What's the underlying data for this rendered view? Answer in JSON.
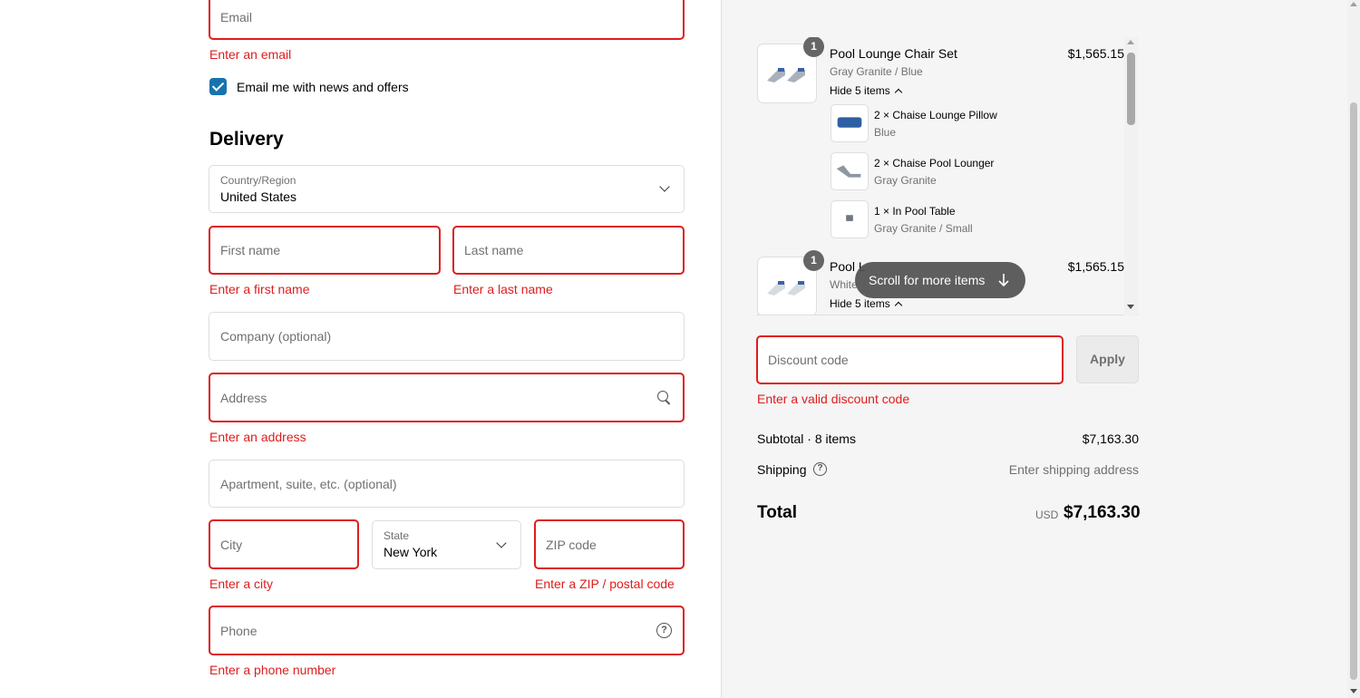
{
  "contact": {
    "email_placeholder": "Email",
    "email_error": "Enter an email",
    "news_label": "Email me with news and offers"
  },
  "delivery": {
    "heading": "Delivery",
    "country_label": "Country/Region",
    "country_value": "United States",
    "first_name_placeholder": "First name",
    "first_name_error": "Enter a first name",
    "last_name_placeholder": "Last name",
    "last_name_error": "Enter a last name",
    "company_placeholder": "Company (optional)",
    "address_placeholder": "Address",
    "address_error": "Enter an address",
    "apartment_placeholder": "Apartment, suite, etc. (optional)",
    "city_placeholder": "City",
    "city_error": "Enter a city",
    "state_label": "State",
    "state_value": "New York",
    "zip_placeholder": "ZIP code",
    "zip_error": "Enter a ZIP / postal code",
    "phone_placeholder": "Phone",
    "phone_error": "Enter a phone number"
  },
  "cart": {
    "items": [
      {
        "quantity": "1",
        "title": "Pool Lounge Chair Set",
        "variant": "Gray Granite / Blue",
        "price": "$1,565.15",
        "toggle": "Hide 5 items",
        "components": [
          {
            "title": "2 × Chaise Lounge Pillow",
            "variant": "Blue"
          },
          {
            "title": "2 × Chaise Pool Lounger",
            "variant": "Gray Granite"
          },
          {
            "title": "1 × In Pool Table",
            "variant": "Gray Granite / Small"
          }
        ]
      },
      {
        "quantity": "1",
        "title": "Pool L",
        "variant": "White",
        "price": "$1,565.15",
        "toggle": "Hide 5 items"
      }
    ],
    "scroll_hint": "Scroll for more items"
  },
  "discount": {
    "placeholder": "Discount code",
    "apply_label": "Apply",
    "error": "Enter a valid discount code"
  },
  "summary": {
    "subtotal_label": "Subtotal · 8 items",
    "subtotal_value": "$7,163.30",
    "shipping_label": "Shipping",
    "shipping_value": "Enter shipping address",
    "total_label": "Total",
    "currency": "USD",
    "total_value": "$7,163.30"
  },
  "colors": {
    "error": "#dd1d1d",
    "accent": "#1773b0",
    "sidebar_bg": "#f5f5f5"
  }
}
